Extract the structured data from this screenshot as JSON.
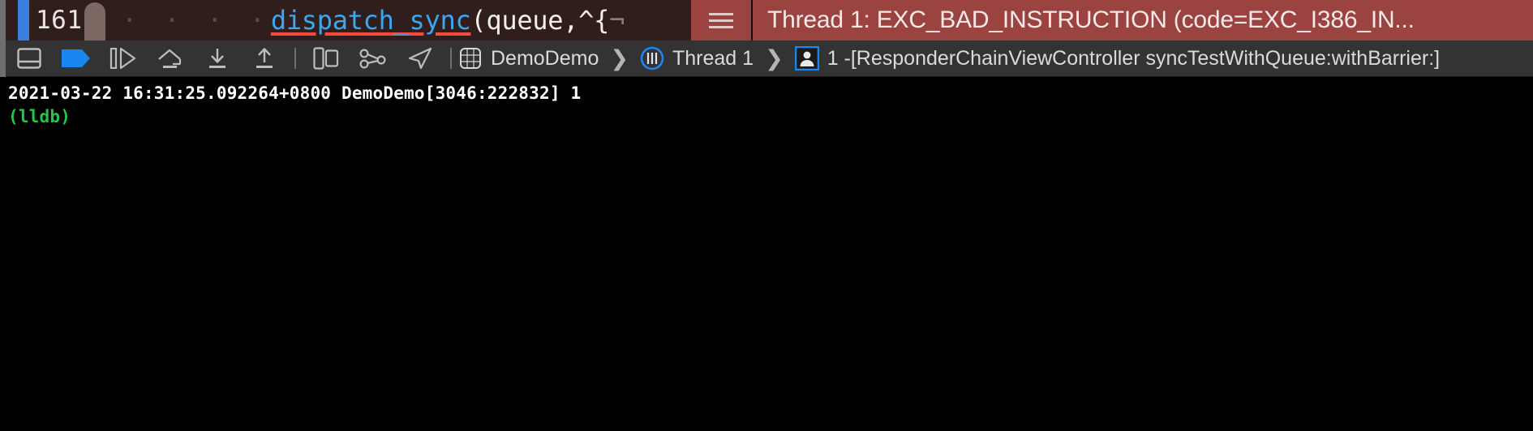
{
  "editor": {
    "line_number": "161",
    "indent_dots": "· · · ·",
    "function_name": "dispatch_sync",
    "code_after": "(queue,^{",
    "code_trailing_glyph": "¬",
    "breakpoint_marker": "breakpoint-marker"
  },
  "error_banner": {
    "message": "Thread 1: EXC_BAD_INSTRUCTION (code=EXC_I386_IN...",
    "handle_icon": "hamburger-lines-icon",
    "background_color": "#9a4340"
  },
  "toolbar": {
    "icons": [
      {
        "name": "hide-debug-area-icon",
        "title": "Hide Debug Area"
      },
      {
        "name": "breakpoint-toggle-icon",
        "title": "Deactivate Breakpoints"
      },
      {
        "name": "continue-execution-icon",
        "title": "Continue Program Execution"
      },
      {
        "name": "step-over-icon",
        "title": "Step Over"
      },
      {
        "name": "step-into-icon",
        "title": "Step Into"
      },
      {
        "name": "step-out-icon",
        "title": "Step Out"
      },
      {
        "name": "debug-view-hierarchy-icon",
        "title": "Debug View Hierarchy"
      },
      {
        "name": "debug-memory-graph-icon",
        "title": "Debug Memory Graph"
      },
      {
        "name": "simulate-location-icon",
        "title": "Simulate Location"
      }
    ],
    "breadcrumb": {
      "process_icon": "process-cube-icon",
      "process_label": "DemoDemo",
      "thread_icon": "thread-icon",
      "thread_label": "Thread 1",
      "frame_icon": "stack-frame-person-icon",
      "frame_label": "1 -[ResponderChainViewController syncTestWithQueue:withBarrier:]",
      "separator": "❯"
    }
  },
  "console": {
    "lines": [
      {
        "text": "2021-03-22 16:31:25.092264+0800 DemoDemo[3046:222832] 1",
        "color": "white"
      },
      {
        "text": "(lldb)",
        "color": "green"
      }
    ],
    "line1": "2021-03-22 16:31:25.092264+0800 DemoDemo[3046:222832] 1",
    "line2": "(lldb)",
    "background_color": "#000000",
    "prompt_color": "#25c44a"
  }
}
